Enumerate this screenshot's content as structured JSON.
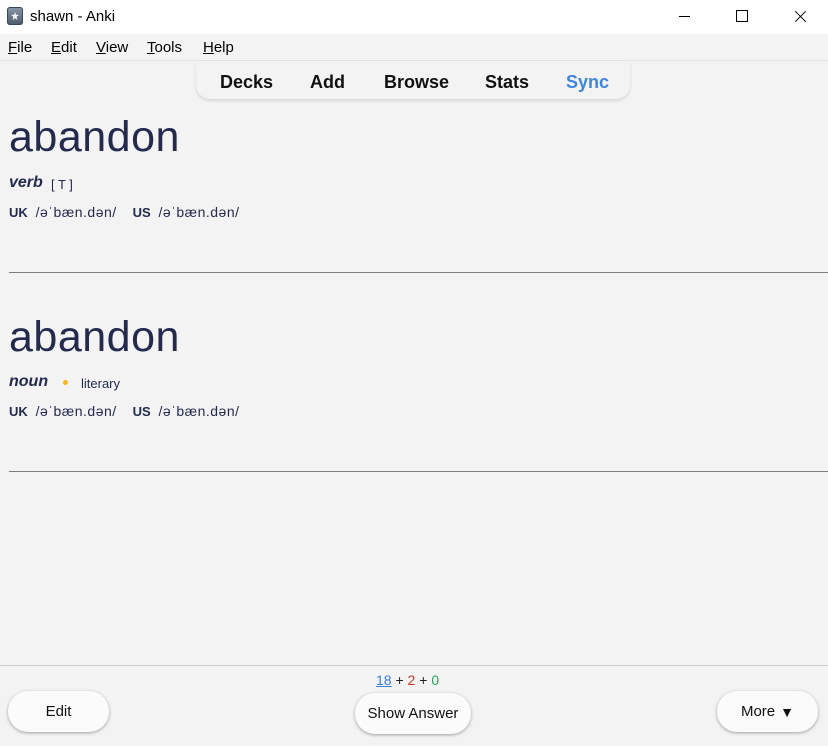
{
  "window": {
    "title": "shawn - Anki"
  },
  "menu": {
    "file": {
      "u": "F",
      "rest": "ile"
    },
    "edit": {
      "u": "E",
      "rest": "dit"
    },
    "view": {
      "u": "V",
      "rest": "iew"
    },
    "tools": {
      "u": "T",
      "rest": "ools"
    },
    "help": {
      "u": "H",
      "rest": "elp"
    }
  },
  "toolbar": {
    "decks": "Decks",
    "add": "Add",
    "browse": "Browse",
    "stats": "Stats",
    "sync": "Sync",
    "sync_color": "#3f85dc"
  },
  "entries": [
    {
      "word": "abandon",
      "pos": "verb",
      "grammar": "[ T ]",
      "uk_label": "UK",
      "uk_ipa": "/əˈbæn.dən/",
      "us_label": "US",
      "us_ipa": "/əˈbæn.dən/"
    },
    {
      "word": "abandon",
      "pos": "noun",
      "register": "literary",
      "uk_label": "UK",
      "uk_ipa": "/əˈbæn.dən/",
      "us_label": "US",
      "us_ipa": "/əˈbæn.dən/"
    }
  ],
  "counts": {
    "new": "18",
    "plus1": "+",
    "learn": "2",
    "plus2": "+",
    "review": "0",
    "new_color": "#3b7dd8",
    "learn_color": "#c0392b",
    "review_color": "#27a559"
  },
  "buttons": {
    "edit": "Edit",
    "show_answer": "Show Answer",
    "more": "More",
    "more_arrow": "▼"
  }
}
